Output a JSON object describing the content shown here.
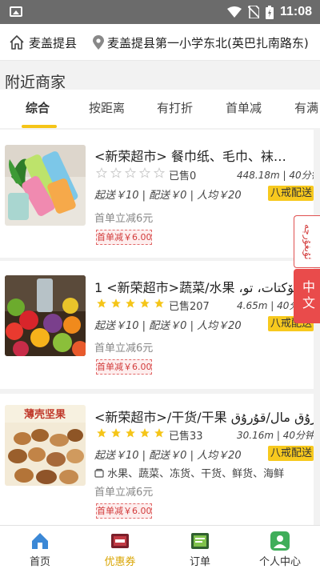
{
  "status_bar": {
    "time": "11:08"
  },
  "header": {
    "county": "麦盖提县",
    "address": "麦盖提县第一小学东北(英巴扎南路东)"
  },
  "section_title": "附近商家",
  "tabs": [
    "综合",
    "按距离",
    "有打折",
    "首单减",
    "有满"
  ],
  "active_tab": 0,
  "lang_tabs": {
    "uyghur": "ئۇيغۇرچە",
    "chinese": "中文"
  },
  "stores": [
    {
      "name": "<新荣超市> 餐巾纸、毛巾、袜…",
      "rating": 0,
      "sold": "已售0",
      "distance": "448.18m | 40分钟",
      "fees": "起送￥10 | 配送￥0 | 人均￥20",
      "delivery_badge": "八戒配送",
      "promo": "首单立减6元",
      "coupon": "首单减￥6.00"
    },
    {
      "name": "1 <新荣超市>蔬菜/水果 ،كۆكتات، تو",
      "rating": 5,
      "sold": "已售207",
      "distance": "4.65m | 40分钟",
      "fees": "起送￥10 | 配送￥0 | 人均￥20",
      "delivery_badge": "八戒配送",
      "promo": "首单立减6元",
      "coupon": "首单减￥6.00"
    },
    {
      "name": "<新荣超市>/干货/干果 قۇرۇق مال/قۇرۇق",
      "rating": 5,
      "sold": "已售33",
      "distance": "30.16m | 40分钟",
      "fees": "起送￥10 | 配送￥0 | 人均￥20",
      "delivery_badge": "八戒配送",
      "categories": "水果、蔬菜、冻货、干货、鲜货、海鲜",
      "promo": "首单立减6元",
      "coupon": "首单减￥6.00",
      "thumb_caption": "薄壳坚果"
    }
  ],
  "bottom_nav": [
    {
      "label": "首页",
      "icon": "home-icon"
    },
    {
      "label": "优惠券",
      "icon": "coupon-icon"
    },
    {
      "label": "订单",
      "icon": "order-icon"
    },
    {
      "label": "个人中心",
      "icon": "profile-icon"
    }
  ],
  "active_nav": 1,
  "colors": {
    "accent": "#f5c518",
    "badge": "#f7c91e",
    "red": "#e94b4b",
    "status_bar": "#6b6b6b"
  }
}
